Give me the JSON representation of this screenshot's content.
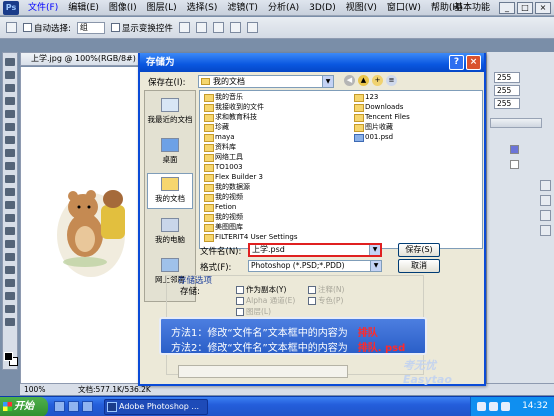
{
  "ps": {
    "menu": [
      "文件(F)",
      "编辑(E)",
      "图像(I)",
      "图层(L)",
      "选择(S)",
      "滤镜(T)",
      "分析(A)",
      "3D(D)",
      "视图(V)",
      "窗口(W)",
      "帮助(H)"
    ],
    "zoom": "100%",
    "workspace": "基本功能",
    "options": {
      "auto_select": "自动选择:",
      "auto_select_value": "组",
      "show_transform": "显示变换控件"
    },
    "doc_tab": "上学.jpg @ 100%(RGB/8#)",
    "status_zoom": "100%",
    "status_doc": "文档:577.1K/536.2K",
    "right_values": [
      "255",
      "255",
      "255"
    ]
  },
  "dialog": {
    "title": "存储为",
    "help": "?",
    "close": "×",
    "save_in_label": "保存在(I):",
    "save_in_value": "我的文档",
    "places": [
      "我最近的文档",
      "桌面",
      "我的文档",
      "我的电脑",
      "网上邻居"
    ],
    "files_left": [
      "我的音乐",
      "我接收到的文件",
      "求和教育科技",
      "珍藏",
      "maya",
      "资料库",
      "网络工具",
      "TO1003",
      "Flex Builder 3",
      "我的数据源",
      "我的视频",
      "Fetion",
      "我的视频",
      "美图图库",
      "FILTERIT4 User Settings"
    ],
    "files_right": [
      "123",
      "Downloads",
      "Tencent Files",
      "图片收藏",
      "001.psd"
    ],
    "filename_label": "文件名(N):",
    "filename_value": "上学.psd",
    "format_label": "格式(F):",
    "format_value": "Photoshop (*.PSD;*.PDD)",
    "save_button": "保存(S)",
    "cancel_button": "取消",
    "options_title": "存储选项",
    "save_label": "存储:",
    "as_copy": "作为副本(Y)",
    "annotation": "注释(N)",
    "alpha": "Alpha 通道(E)",
    "spot": "专色(P)",
    "layers": "图层(L)",
    "banner_line1_prefix": "方法1：修改“文件名”文本框中的内容为",
    "banner_line1_value": "排队",
    "banner_line2_prefix": "方法2：修改“文件名”文本框中的内容为",
    "banner_line2_value": "排队. psd",
    "watermark": "考无忧 Easytao"
  },
  "taskbar": {
    "start": "开始",
    "task": "Adobe Photoshop ...",
    "clock": "14:32"
  }
}
